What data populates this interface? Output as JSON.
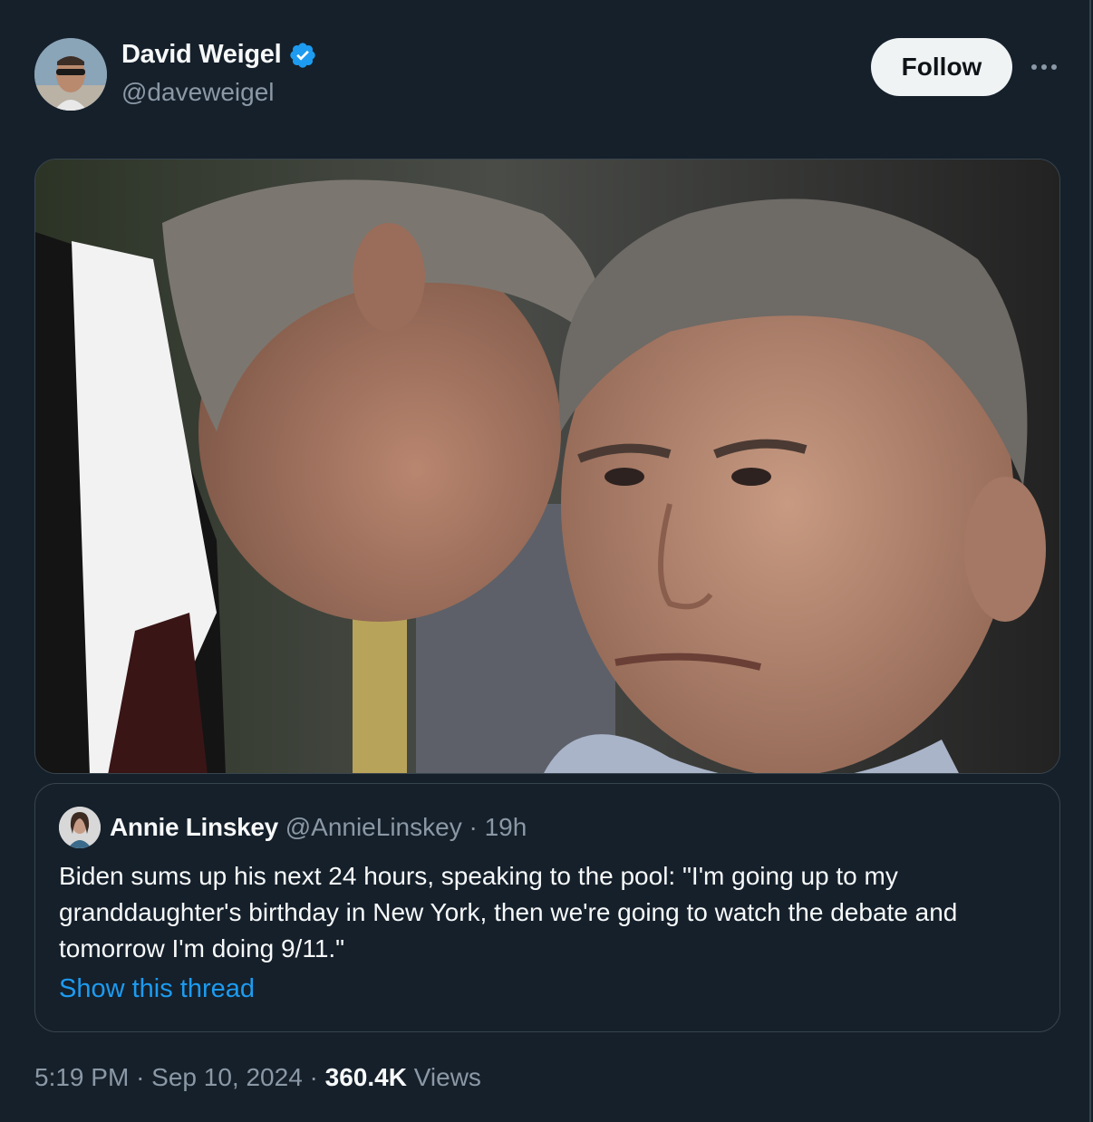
{
  "tweet": {
    "author_name": "David Weigel",
    "author_handle": "@daveweigel",
    "verified_icon": "verified-badge-icon",
    "follow_label": "Follow",
    "more_icon": "more-horizontal-icon",
    "media_alt": "photo",
    "quote": {
      "name": "Annie Linskey",
      "handle": "@AnnieLinskey",
      "separator": "·",
      "time": "19h",
      "text": "Biden sums up his next 24 hours, speaking to the pool: \"I'm going up to my granddaughter's birthday in New York, then we're going to watch the debate and tomorrow I'm doing 9/11.\"",
      "show_thread": "Show this thread"
    },
    "footer": {
      "time": "5:19 PM",
      "sep1": "·",
      "date": "Sep 10, 2024",
      "sep2": "·",
      "views_count": "360.4K",
      "views_label": "Views"
    }
  },
  "colors": {
    "background": "#15202b",
    "accent": "#1d9bf0",
    "secondary_text": "#8b98a5",
    "border": "#38444d"
  }
}
